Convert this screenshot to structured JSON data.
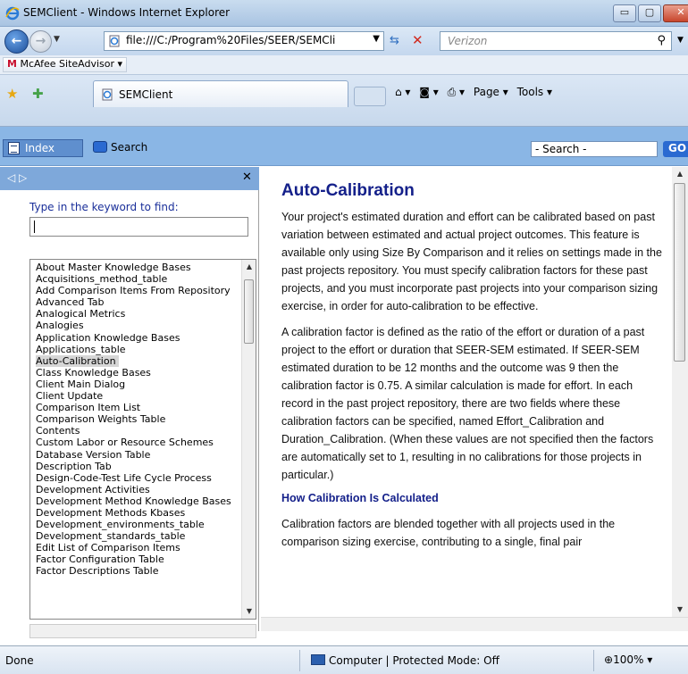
{
  "window": {
    "title": "SEMClient - Windows Internet Explorer",
    "controls": {
      "minimize": "▭",
      "maximize": "▢",
      "close": "✕"
    }
  },
  "address_bar": {
    "url": "file:///C:/Program%20Files/SEER/SEMCli",
    "search_placeholder": "Verizon"
  },
  "mcafee": {
    "label_m": "M",
    "label_rest": "McAfee SiteAdvisor ▾"
  },
  "tab": {
    "label": "SEMClient"
  },
  "command_bar": {
    "page": "Page ▾",
    "tools": "Tools ▾"
  },
  "help_toolbar": {
    "index_label": "Index",
    "search_label": "Search",
    "search_field": "- Search -",
    "go_label": "GO"
  },
  "left_pane": {
    "nav_arrows": "◁ ▷",
    "close": "✕",
    "prompt": "Type in the keyword to find:",
    "keyword_value": "",
    "items": [
      "About Master Knowledge Bases",
      "Acquisitions_method_table",
      "Add Comparison Items From Repository",
      "Advanced Tab",
      "Analogical Metrics",
      "Analogies",
      "Application Knowledge Bases",
      "Applications_table",
      "Auto-Calibration",
      "Class Knowledge Bases",
      "Client Main Dialog",
      "Client Update",
      "Comparison Item List",
      "Comparison Weights Table",
      "Contents",
      "Custom Labor or Resource Schemes",
      "Database Version Table",
      "Description Tab",
      "Design-Code-Test Life Cycle Process",
      "Development Activities",
      "Development Method Knowledge Bases",
      "Development Methods Kbases",
      "Development_environments_table",
      "Development_standards_table",
      "Edit List of Comparison Items",
      "Factor Configuration Table",
      "Factor Descriptions Table"
    ],
    "selected_item": "Auto-Calibration"
  },
  "content": {
    "title": "Auto-Calibration",
    "para1": "Your project's estimated duration and effort can be calibrated based on past variation between estimated and actual project outcomes. This feature is available only using Size By Comparison and it relies on settings made in the past projects repository. You must specify calibration factors for these past projects, and you must incorporate past projects into your comparison sizing exercise, in order for auto-calibration to be effective.",
    "para2": "A calibration factor is defined as the ratio of the effort or duration of a past project to the effort or duration that SEER-SEM estimated. If SEER-SEM estimated duration to be 12 months and the outcome was 9 then the calibration factor is 0.75. A similar calculation is made for effort. In each record in the past project repository, there are two fields where these calibration factors can be specified, named Effort_Calibration and Duration_Calibration. (When these values are not specified then the factors are automatically set to 1, resulting in no calibrations for those projects in particular.)",
    "subheading": "How Calibration Is Calculated",
    "para3": "Calibration factors are blended together with all projects used in the comparison sizing exercise, contributing to a single, final pair"
  },
  "status_bar": {
    "left": "Done",
    "zone": "Computer | Protected Mode: Off",
    "zoom": "100%"
  }
}
